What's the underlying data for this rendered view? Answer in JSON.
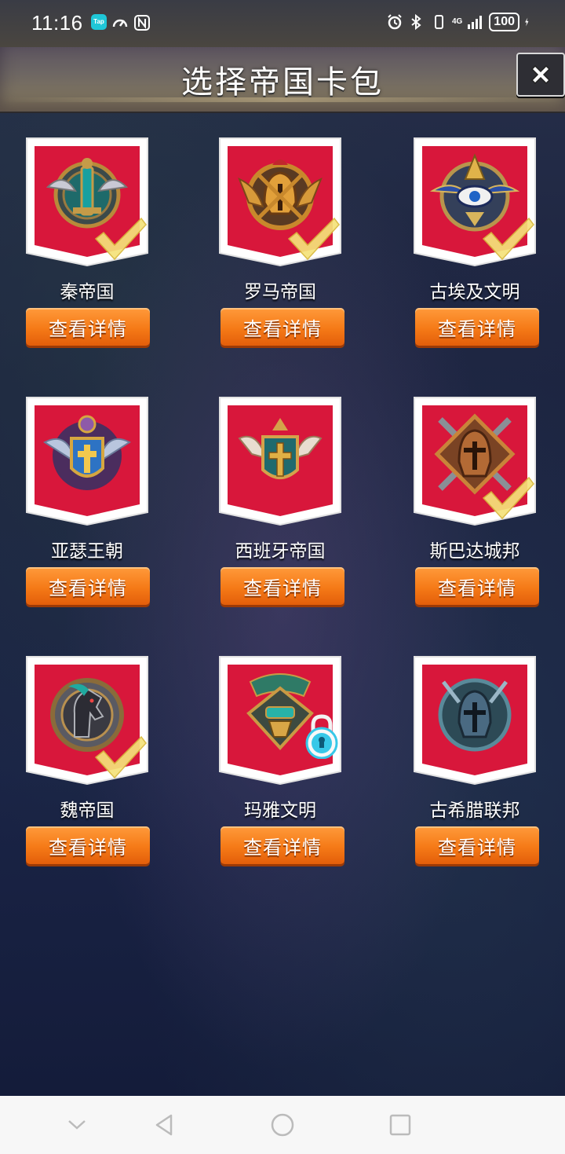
{
  "status_bar": {
    "time": "11:16",
    "tap_label": "Tap",
    "network": "4G",
    "battery": "100"
  },
  "header": {
    "title": "选择帝国卡包"
  },
  "colors": {
    "card_red": "#d8173b",
    "button_orange": "#f57a17",
    "check_yellow": "#f5e27a",
    "lock_cyan": "#37c8e8"
  },
  "empires": [
    {
      "name": "秦帝国",
      "button": "查看详情",
      "emblem": "winged-sword-emblem",
      "status": "checked"
    },
    {
      "name": "罗马帝国",
      "button": "查看详情",
      "emblem": "roman-helmet-emblem",
      "status": "checked"
    },
    {
      "name": "古埃及文明",
      "button": "查看详情",
      "emblem": "eye-of-horus-emblem",
      "status": "checked"
    },
    {
      "name": "亚瑟王朝",
      "button": "查看详情",
      "emblem": "winged-shield-emblem",
      "status": "none"
    },
    {
      "name": "西班牙帝国",
      "button": "查看详情",
      "emblem": "cross-shield-emblem",
      "status": "none"
    },
    {
      "name": "斯巴达城邦",
      "button": "查看详情",
      "emblem": "spartan-helmet-emblem",
      "status": "checked"
    },
    {
      "name": "魏帝国",
      "button": "查看详情",
      "emblem": "horse-head-emblem",
      "status": "checked"
    },
    {
      "name": "玛雅文明",
      "button": "查看详情",
      "emblem": "mayan-mask-emblem",
      "status": "locked"
    },
    {
      "name": "古希腊联邦",
      "button": "查看详情",
      "emblem": "greek-helmet-emblem",
      "status": "none"
    }
  ],
  "nav": {
    "items": [
      "back-icon",
      "home-icon",
      "recents-icon",
      "hide-icon"
    ]
  }
}
